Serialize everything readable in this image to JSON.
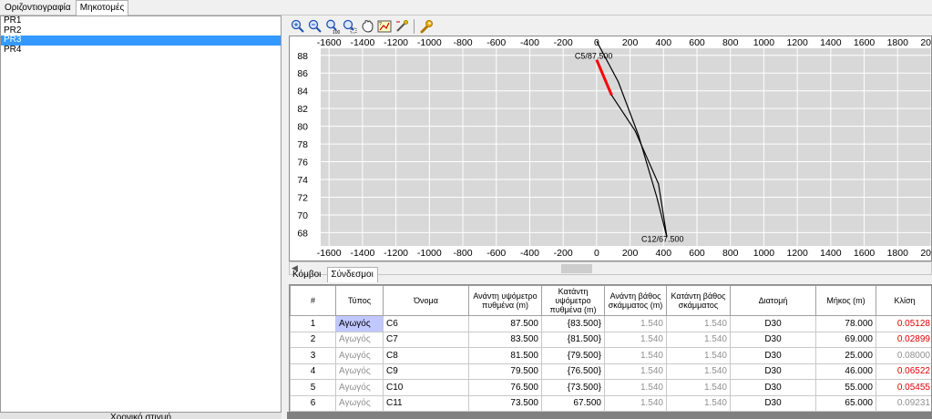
{
  "tabs_top": [
    "Οριζοντιογραφία",
    "Μηκοτομές"
  ],
  "tabs_top_active": 1,
  "profiles": [
    "PR1",
    "PR2",
    "PR3",
    "PR4"
  ],
  "profiles_selected": 2,
  "left_bottom_button": "Χρονικό στιγμή",
  "toolbar_icons": [
    "zoom-in-icon",
    "zoom-out-icon",
    "zoom-100-icon",
    "zoom-window-icon",
    "pan-icon",
    "zoom-extents-icon",
    "properties-icon",
    "settings-wrench-icon"
  ],
  "chart_data": {
    "type": "line",
    "x_ticks": [
      -1600,
      -1400,
      -1200,
      -1000,
      -800,
      -600,
      -400,
      -200,
      0,
      200,
      400,
      600,
      800,
      1000,
      1200,
      1400,
      1600,
      1800,
      2000
    ],
    "y_ticks": [
      88,
      86,
      84,
      82,
      80,
      78,
      76,
      74,
      72,
      70,
      68
    ],
    "xlim": [
      -1650,
      2000
    ],
    "ylim": [
      66.5,
      88.8
    ],
    "top_label": "C5/87.500",
    "bottom_label": "C12/67.500",
    "profile_lines": [
      {
        "name": "ground",
        "points": [
          [
            0,
            89.6
          ],
          [
            130,
            85.0
          ],
          [
            250,
            79.0
          ],
          [
            360,
            72.0
          ],
          [
            420,
            67.5
          ]
        ]
      },
      {
        "name": "invert",
        "points": [
          [
            0,
            87.5
          ],
          [
            90,
            83.5
          ],
          [
            160,
            81.5
          ],
          [
            230,
            79.5
          ],
          [
            300,
            76.5
          ],
          [
            370,
            73.5
          ],
          [
            420,
            67.5
          ]
        ]
      }
    ],
    "highlight": {
      "points": [
        [
          0,
          87.5
        ],
        [
          90,
          83.5
        ]
      ],
      "color": "#ff0000"
    },
    "colors": {
      "plot_bg": "#d8d8d8",
      "grid": "#ffffff",
      "line": "#000000"
    }
  },
  "tabs_mid": [
    "Κόμβοι",
    "Σύνδεσμοι"
  ],
  "tabs_mid_active": 1,
  "table": {
    "headers": [
      "#",
      "Τύπος",
      "Όνομα",
      "Ανάντη υψόμετρο πυθμένα (m)",
      "Κατάντη υψόμετρο πυθμένα (m)",
      "Ανάντη βάθος σκάμματος (m)",
      "Κατάντη βάθος σκάμματος",
      "Διατομή",
      "Μήκος (m)",
      "Κλίση"
    ],
    "rows": [
      {
        "num": "1",
        "type": "Αγωγός",
        "name": "C6",
        "up_elev": "87.500",
        "down_elev": "{83.500}",
        "up_depth": "1.540",
        "down_depth": "1.540",
        "section": "D30",
        "length": "78.000",
        "slope": "0.05128",
        "slope_red": true,
        "type_selected": true
      },
      {
        "num": "2",
        "type": "Αγωγός",
        "name": "C7",
        "up_elev": "83.500",
        "down_elev": "{81.500}",
        "up_depth": "1.540",
        "down_depth": "1.540",
        "section": "D30",
        "length": "69.000",
        "slope": "0.02899",
        "slope_red": true,
        "type_selected": false
      },
      {
        "num": "3",
        "type": "Αγωγός",
        "name": "C8",
        "up_elev": "81.500",
        "down_elev": "{79.500}",
        "up_depth": "1.540",
        "down_depth": "1.540",
        "section": "D30",
        "length": "25.000",
        "slope": "0.08000",
        "slope_red": false,
        "type_selected": false
      },
      {
        "num": "4",
        "type": "Αγωγός",
        "name": "C9",
        "up_elev": "79.500",
        "down_elev": "{76.500}",
        "up_depth": "1.540",
        "down_depth": "1.540",
        "section": "D30",
        "length": "46.000",
        "slope": "0.06522",
        "slope_red": true,
        "type_selected": false
      },
      {
        "num": "5",
        "type": "Αγωγός",
        "name": "C10",
        "up_elev": "76.500",
        "down_elev": "{73.500}",
        "up_depth": "1.540",
        "down_depth": "1.540",
        "section": "D30",
        "length": "55.000",
        "slope": "0.05455",
        "slope_red": true,
        "type_selected": false
      },
      {
        "num": "6",
        "type": "Αγωγός",
        "name": "C11",
        "up_elev": "73.500",
        "down_elev": "67.500",
        "up_depth": "1.540",
        "down_depth": "1.540",
        "section": "D30",
        "length": "65.000",
        "slope": "0.09231",
        "slope_red": false,
        "type_selected": false
      }
    ]
  }
}
